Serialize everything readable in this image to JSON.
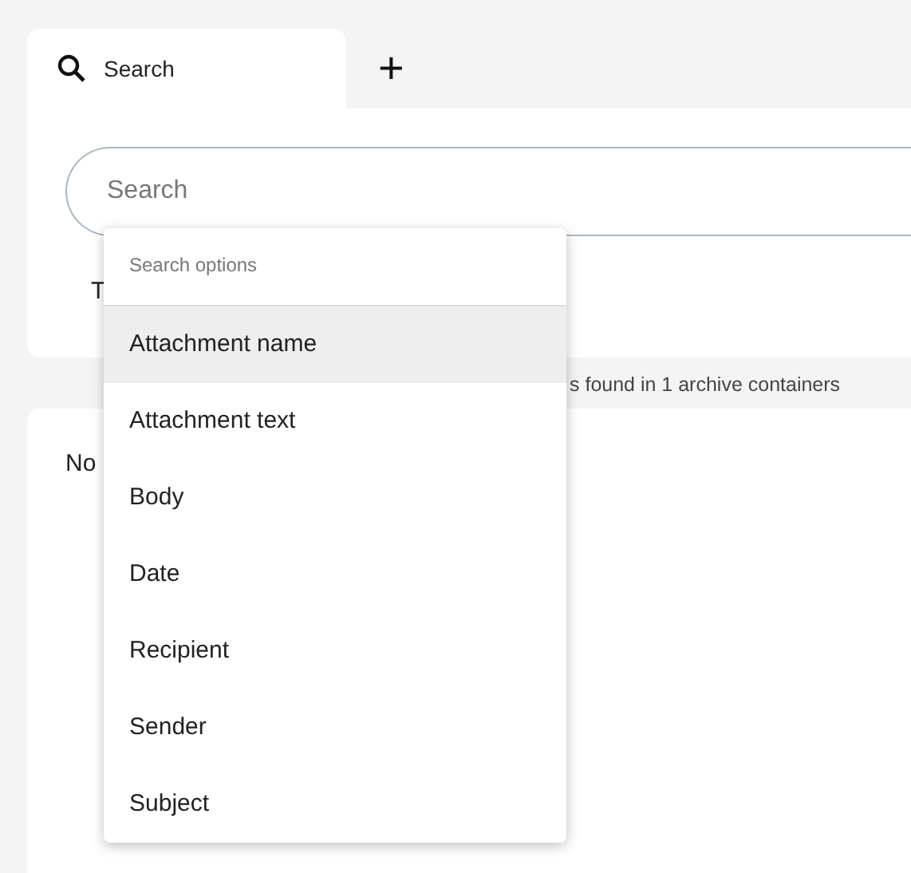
{
  "tabs": [
    {
      "label": "Search",
      "selected": true
    }
  ],
  "add_tab": {
    "label": "+"
  },
  "search": {
    "placeholder": "Search"
  },
  "options_hint": "T",
  "status": "s found in 1 archive containers",
  "results": {
    "text": "No"
  },
  "menu": {
    "header": "Search options",
    "items": [
      {
        "label": "Attachment name",
        "selected": true
      },
      {
        "label": "Attachment text",
        "selected": false
      },
      {
        "label": "Body",
        "selected": false
      },
      {
        "label": "Date",
        "selected": false
      },
      {
        "label": "Recipient",
        "selected": false
      },
      {
        "label": "Sender",
        "selected": false
      },
      {
        "label": "Subject",
        "selected": false
      }
    ]
  }
}
